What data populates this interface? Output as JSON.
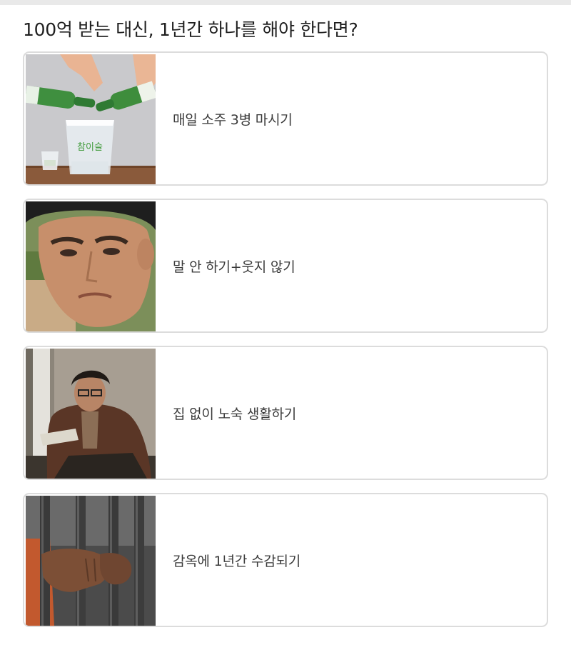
{
  "question": "100억 받는 대신, 1년간 하나를 해야 한다면?",
  "options": [
    {
      "label": "매일 소주 3병 마시기",
      "image": "soju-pouring-photo",
      "glass_text": "참이슬"
    },
    {
      "label": "말 안 하기+웃지 않기",
      "image": "silent-man-face-photo"
    },
    {
      "label": "집 없이 노숙 생활하기",
      "image": "homeless-man-photo"
    },
    {
      "label": "감옥에 1년간 수감되기",
      "image": "prison-bars-hands-photo"
    }
  ]
}
